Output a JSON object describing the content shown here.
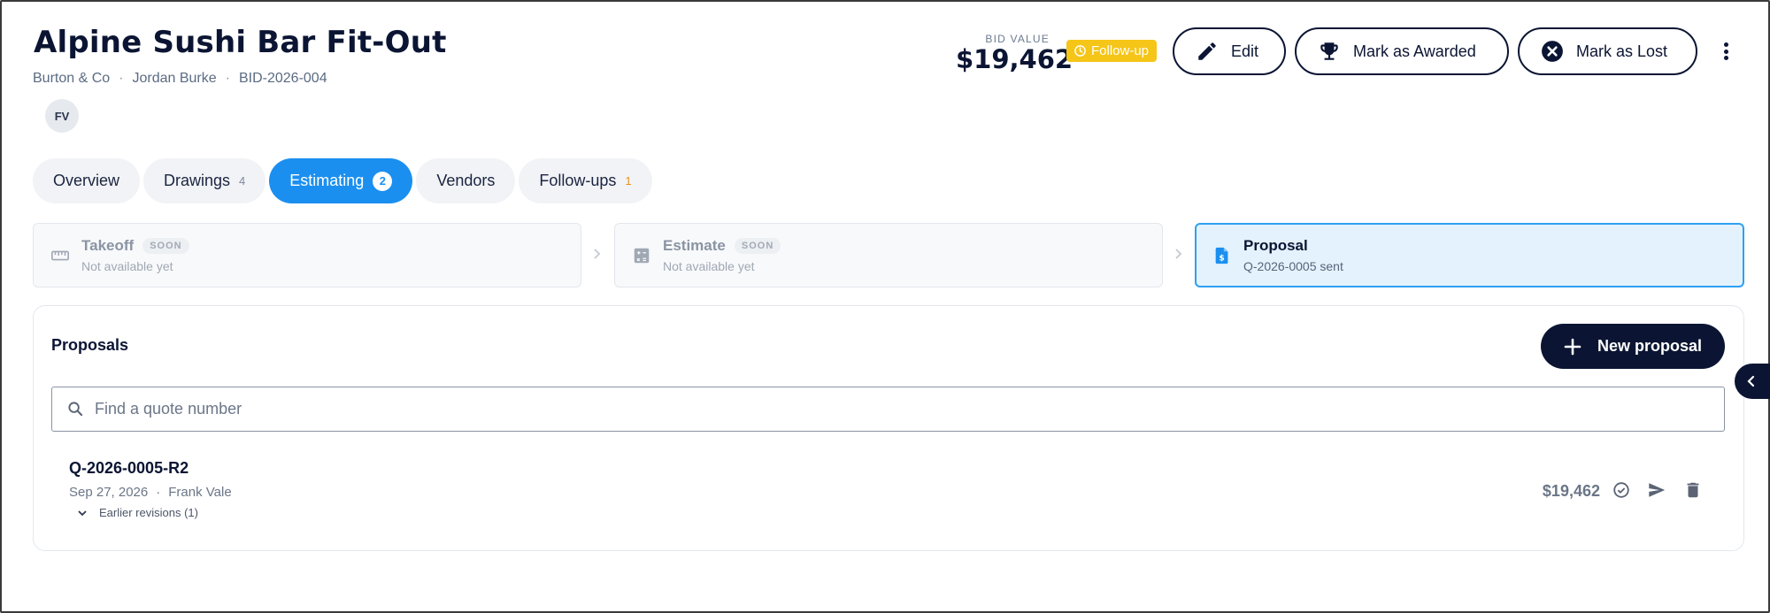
{
  "header": {
    "title": "Alpine Sushi Bar Fit-Out",
    "client": "Burton & Co",
    "contact": "Jordan Burke",
    "bid_id": "BID-2026-004",
    "separator": "·",
    "avatar_initials": "FV",
    "bid_value_label": "BID VALUE",
    "bid_value": "$19,462",
    "status_badge": "Follow-up",
    "status_color": "#f5c518"
  },
  "actions": {
    "edit_label": "Edit",
    "award_label": "Mark as Awarded",
    "lost_label": "Mark as Lost"
  },
  "tabs": [
    {
      "label": "Overview",
      "count": ""
    },
    {
      "label": "Drawings",
      "count": "4"
    },
    {
      "label": "Estimating",
      "count": "2",
      "active": true
    },
    {
      "label": "Vendors",
      "count": ""
    },
    {
      "label": "Follow-ups",
      "count": "1"
    }
  ],
  "stepper": {
    "takeoff": {
      "title": "Takeoff",
      "tag": "SOON",
      "subtitle": "Not available yet",
      "icon": "ruler-icon"
    },
    "estimate": {
      "title": "Estimate",
      "tag": "SOON",
      "subtitle": "Not available yet",
      "icon": "calculator-icon"
    },
    "proposal": {
      "title": "Proposal",
      "subtitle": "Q-2026-0005 sent",
      "icon": "invoice-dollar-icon"
    }
  },
  "proposals": {
    "title": "Proposals",
    "new_button_label": "New proposal",
    "search_placeholder": "Find a quote number",
    "search_value": "",
    "items": [
      {
        "number": "Q-2026-0005-R2",
        "date": "Sep 27, 2026",
        "author": "Frank Vale",
        "revisions_label": "Earlier revisions (1)",
        "amount": "$19,462"
      }
    ]
  },
  "colors": {
    "primary_dark": "#0b1533",
    "accent_blue": "#1a8ff0",
    "follow_up_yellow": "#f5c518",
    "proposal_highlight": "#e4f2fd"
  }
}
